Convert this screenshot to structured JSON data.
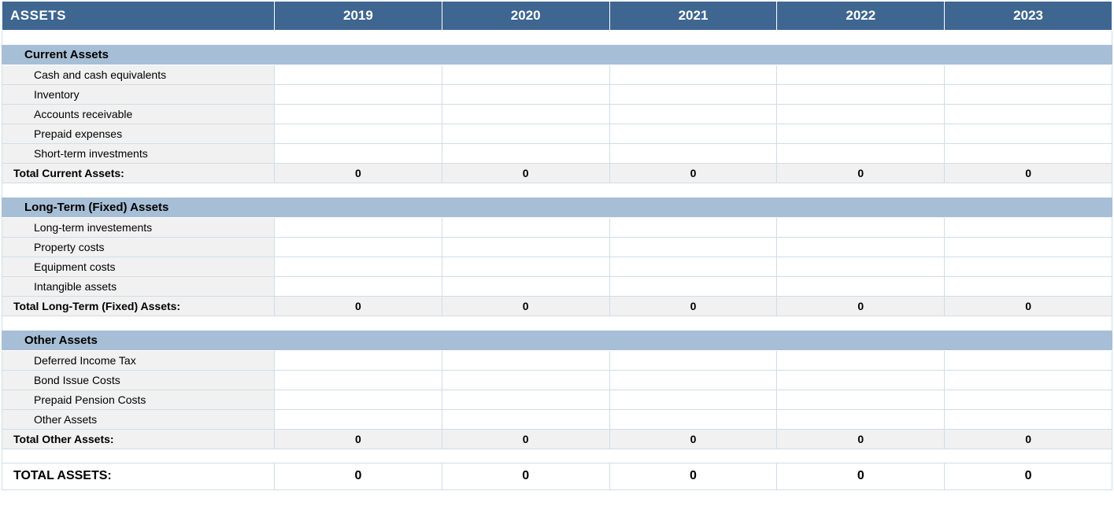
{
  "header": {
    "title": "ASSETS",
    "years": [
      "2019",
      "2020",
      "2021",
      "2022",
      "2023"
    ]
  },
  "sections": [
    {
      "name": "Current Assets",
      "items": [
        {
          "label": "Cash and cash equivalents",
          "values": [
            "",
            "",
            "",
            "",
            ""
          ]
        },
        {
          "label": "Inventory",
          "values": [
            "",
            "",
            "",
            "",
            ""
          ]
        },
        {
          "label": "Accounts receivable",
          "values": [
            "",
            "",
            "",
            "",
            ""
          ]
        },
        {
          "label": "Prepaid expenses",
          "values": [
            "",
            "",
            "",
            "",
            ""
          ]
        },
        {
          "label": "Short-term investments",
          "values": [
            "",
            "",
            "",
            "",
            ""
          ]
        }
      ],
      "subtotal_label": "Total Current Assets:",
      "subtotal_values": [
        "0",
        "0",
        "0",
        "0",
        "0"
      ]
    },
    {
      "name": "Long-Term (Fixed) Assets",
      "items": [
        {
          "label": "Long-term investements",
          "values": [
            "",
            "",
            "",
            "",
            ""
          ]
        },
        {
          "label": "Property costs",
          "values": [
            "",
            "",
            "",
            "",
            ""
          ]
        },
        {
          "label": "Equipment costs",
          "values": [
            "",
            "",
            "",
            "",
            ""
          ]
        },
        {
          "label": "Intangible assets",
          "values": [
            "",
            "",
            "",
            "",
            ""
          ]
        }
      ],
      "subtotal_label": "Total Long-Term (Fixed) Assets:",
      "subtotal_values": [
        "0",
        "0",
        "0",
        "0",
        "0"
      ]
    },
    {
      "name": "Other Assets",
      "items": [
        {
          "label": "Deferred Income Tax",
          "values": [
            "",
            "",
            "",
            "",
            ""
          ]
        },
        {
          "label": "Bond Issue Costs",
          "values": [
            "",
            "",
            "",
            "",
            ""
          ]
        },
        {
          "label": "Prepaid Pension Costs",
          "values": [
            "",
            "",
            "",
            "",
            ""
          ]
        },
        {
          "label": "Other Assets",
          "values": [
            "",
            "",
            "",
            "",
            ""
          ]
        }
      ],
      "subtotal_label": "Total Other Assets:",
      "subtotal_values": [
        "0",
        "0",
        "0",
        "0",
        "0"
      ]
    }
  ],
  "grand_total": {
    "label": "TOTAL ASSETS:",
    "values": [
      "0",
      "0",
      "0",
      "0",
      "0"
    ]
  }
}
